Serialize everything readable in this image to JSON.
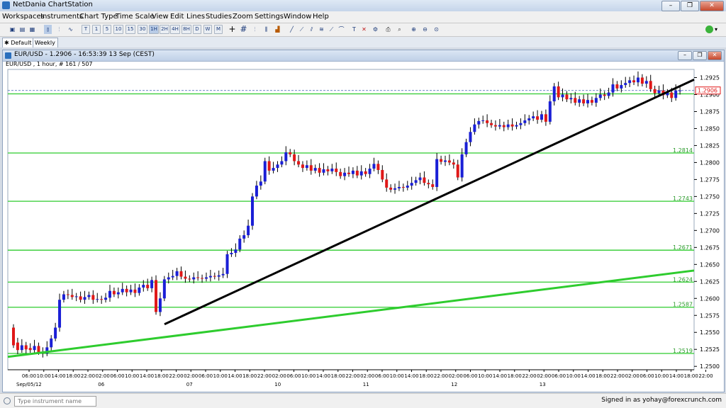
{
  "app": {
    "title": "NetDania ChartStation"
  },
  "menu": [
    "Workspaces",
    "Instruments",
    "Chart Type",
    "Time Scale",
    "View",
    "Edit",
    "Lines",
    "Studies",
    "Zoom",
    "Settings",
    "Window",
    "Help"
  ],
  "timeframes": [
    "T",
    "1",
    "5",
    "10",
    "15",
    "30",
    "1H",
    "2H",
    "4H",
    "8H",
    "D",
    "W",
    "M"
  ],
  "selected_timeframe": "1H",
  "tabs": [
    {
      "label": "Default"
    },
    {
      "label": "Weekly"
    }
  ],
  "chart_window": {
    "title": "EUR/USD - 1.2906 - 16:53:39 13 Sep (CEST)",
    "info": "EUR/USD , 1 hour, # 161 / 507"
  },
  "status": {
    "instrument_placeholder": "Type instrument name",
    "signed_in": "Signed in as yohay@forexcrunch.com"
  },
  "colors": {
    "up": "#1a1fd6",
    "down": "#e01818",
    "level_line": "#2ecc2e",
    "trend_black": "#000000",
    "trend_green": "#2ecc2e",
    "current_price": "#e01818"
  },
  "chart_data": {
    "type": "candlestick",
    "instrument": "EUR/USD",
    "interval": "1 hour",
    "y_ticks": [
      "1.2925",
      "1.2900",
      "1.2875",
      "1.2850",
      "1.2825",
      "1.2800",
      "1.2775",
      "1.2750",
      "1.2725",
      "1.2700",
      "1.2675",
      "1.2650",
      "1.2625",
      "1.2600",
      "1.2575",
      "1.2550",
      "1.2525",
      "1.2500"
    ],
    "ylim": [
      1.2495,
      1.2937
    ],
    "x_hour_ticks": [
      "06:00",
      "10:00",
      "14:00",
      "18:00",
      "22:00",
      "02:00",
      "06:00",
      "10:00",
      "14:00",
      "18:00",
      "22:00",
      "02:00",
      "06:00",
      "10:00",
      "14:00",
      "18:00",
      "22:00",
      "02:00",
      "06:00",
      "10:00",
      "14:00",
      "18:00",
      "22:00",
      "02:00",
      "06:00",
      "10:00",
      "14:00",
      "18:00",
      "22:00",
      "02:00",
      "06:00",
      "10:00",
      "14:00",
      "18:00",
      "22:00",
      "02:00",
      "06:00",
      "10:00",
      "14:00",
      "18:00",
      "22:00",
      "02:00",
      "06:00",
      "10:00",
      "14:00",
      "18:00",
      "22:00"
    ],
    "x_date_ticks": [
      "Sep/05/12",
      "06",
      "07",
      "10",
      "11",
      "12",
      "13"
    ],
    "current_price": "1.2906",
    "horizontal_levels": [
      "1.2814",
      "1.2743",
      "1.2671",
      "1.2624",
      "1.2587",
      "1.2519"
    ],
    "unlabeled_level": 1.2901,
    "trendlines": [
      {
        "color": "black",
        "from_price": 1.2562,
        "to_price": 1.2922
      },
      {
        "color": "green",
        "from_price": 1.2514,
        "to_price": 1.2641
      }
    ],
    "candles": [
      [
        1.2557,
        1.2531
      ],
      [
        1.2535,
        1.2524
      ],
      [
        1.2524,
        1.2531
      ],
      [
        1.2531,
        1.2525
      ],
      [
        1.2527,
        1.2524
      ],
      [
        1.2524,
        1.253
      ],
      [
        1.253,
        1.2521
      ],
      [
        1.2521,
        1.2519
      ],
      [
        1.2519,
        1.2528
      ],
      [
        1.2528,
        1.2541
      ],
      [
        1.2541,
        1.2557
      ],
      [
        1.2557,
        1.2598
      ],
      [
        1.2598,
        1.2606
      ],
      [
        1.2606,
        1.2605
      ],
      [
        1.2605,
        1.2602
      ],
      [
        1.2602,
        1.2603
      ],
      [
        1.2603,
        1.2598
      ],
      [
        1.2598,
        1.2602
      ],
      [
        1.2602,
        1.2605
      ],
      [
        1.2605,
        1.2598
      ],
      [
        1.2598,
        1.2599
      ],
      [
        1.2599,
        1.2598
      ],
      [
        1.2598,
        1.2601
      ],
      [
        1.2601,
        1.2611
      ],
      [
        1.2611,
        1.2606
      ],
      [
        1.2606,
        1.2609
      ],
      [
        1.2609,
        1.2614
      ],
      [
        1.2614,
        1.2609
      ],
      [
        1.2609,
        1.2613
      ],
      [
        1.2613,
        1.2608
      ],
      [
        1.2608,
        1.2616
      ],
      [
        1.2616,
        1.262
      ],
      [
        1.262,
        1.2615
      ],
      [
        1.2615,
        1.2627
      ],
      [
        1.2627,
        1.258
      ],
      [
        1.258,
        1.26
      ],
      [
        1.26,
        1.2628
      ],
      [
        1.2628,
        1.2631
      ],
      [
        1.2631,
        1.2633
      ],
      [
        1.2633,
        1.264
      ],
      [
        1.264,
        1.2632
      ],
      [
        1.2632,
        1.2629
      ],
      [
        1.2629,
        1.2628
      ],
      [
        1.2628,
        1.2631
      ],
      [
        1.2631,
        1.263
      ],
      [
        1.263,
        1.2629
      ],
      [
        1.2629,
        1.2631
      ],
      [
        1.2631,
        1.2633
      ],
      [
        1.2633,
        1.2632
      ],
      [
        1.2632,
        1.2634
      ],
      [
        1.2634,
        1.2636
      ],
      [
        1.2636,
        1.2665
      ],
      [
        1.2665,
        1.2667
      ],
      [
        1.2667,
        1.2672
      ],
      [
        1.2672,
        1.2688
      ],
      [
        1.2688,
        1.2693
      ],
      [
        1.2693,
        1.2707
      ],
      [
        1.2707,
        1.275
      ],
      [
        1.275,
        1.2766
      ],
      [
        1.2766,
        1.2772
      ],
      [
        1.2772,
        1.2802
      ],
      [
        1.2802,
        1.2788
      ],
      [
        1.2788,
        1.2792
      ],
      [
        1.2792,
        1.2797
      ],
      [
        1.2797,
        1.2802
      ],
      [
        1.2802,
        1.2815
      ],
      [
        1.2815,
        1.2812
      ],
      [
        1.2812,
        1.2802
      ],
      [
        1.2802,
        1.2797
      ],
      [
        1.2797,
        1.2792
      ],
      [
        1.2792,
        1.2796
      ],
      [
        1.2796,
        1.2788
      ],
      [
        1.2788,
        1.2792
      ],
      [
        1.2792,
        1.2785
      ],
      [
        1.2785,
        1.279
      ],
      [
        1.279,
        1.2787
      ],
      [
        1.2787,
        1.2791
      ],
      [
        1.2791,
        1.2786
      ],
      [
        1.2786,
        1.278
      ],
      [
        1.278,
        1.2785
      ],
      [
        1.2785,
        1.2783
      ],
      [
        1.2783,
        1.2788
      ],
      [
        1.2788,
        1.2781
      ],
      [
        1.2781,
        1.2787
      ],
      [
        1.2787,
        1.2783
      ],
      [
        1.2783,
        1.2791
      ],
      [
        1.2791,
        1.2798
      ],
      [
        1.2798,
        1.2789
      ],
      [
        1.2789,
        1.2775
      ],
      [
        1.2775,
        1.2763
      ],
      [
        1.2763,
        1.276
      ],
      [
        1.276,
        1.2762
      ],
      [
        1.2762,
        1.2764
      ],
      [
        1.2764,
        1.2763
      ],
      [
        1.2763,
        1.2766
      ],
      [
        1.2766,
        1.277
      ],
      [
        1.277,
        1.2774
      ],
      [
        1.2774,
        1.2778
      ],
      [
        1.2778,
        1.277
      ],
      [
        1.277,
        1.2768
      ],
      [
        1.2768,
        1.2764
      ],
      [
        1.2764,
        1.2805
      ],
      [
        1.2805,
        1.2801
      ],
      [
        1.2801,
        1.2803
      ],
      [
        1.2803,
        1.28
      ],
      [
        1.28,
        1.2797
      ],
      [
        1.2797,
        1.2778
      ],
      [
        1.2778,
        1.2812
      ],
      [
        1.2812,
        1.283
      ],
      [
        1.283,
        1.2845
      ],
      [
        1.2845,
        1.2856
      ],
      [
        1.2856,
        1.2861
      ],
      [
        1.2861,
        1.2862
      ],
      [
        1.2862,
        1.2858
      ],
      [
        1.2858,
        1.2855
      ],
      [
        1.2855,
        1.2853
      ],
      [
        1.2853,
        1.2855
      ],
      [
        1.2855,
        1.2852
      ],
      [
        1.2852,
        1.2856
      ],
      [
        1.2856,
        1.2853
      ],
      [
        1.2853,
        1.2855
      ],
      [
        1.2855,
        1.2858
      ],
      [
        1.2858,
        1.2862
      ],
      [
        1.2862,
        1.2865
      ],
      [
        1.2865,
        1.2868
      ],
      [
        1.2868,
        1.2863
      ],
      [
        1.2863,
        1.2871
      ],
      [
        1.2871,
        1.286
      ],
      [
        1.286,
        1.289
      ],
      [
        1.289,
        1.2912
      ],
      [
        1.2912,
        1.2896
      ],
      [
        1.2896,
        1.29
      ],
      [
        1.29,
        1.2893
      ],
      [
        1.2893,
        1.2895
      ],
      [
        1.2895,
        1.2888
      ],
      [
        1.2888,
        1.2893
      ],
      [
        1.2893,
        1.2887
      ],
      [
        1.2887,
        1.2892
      ],
      [
        1.2892,
        1.2888
      ],
      [
        1.2888,
        1.2895
      ],
      [
        1.2895,
        1.29
      ],
      [
        1.29,
        1.2898
      ],
      [
        1.2898,
        1.2903
      ],
      [
        1.2903,
        1.2915
      ],
      [
        1.2915,
        1.2909
      ],
      [
        1.2909,
        1.2914
      ],
      [
        1.2914,
        1.2917
      ],
      [
        1.2917,
        1.2921
      ],
      [
        1.2921,
        1.2918
      ],
      [
        1.2918,
        1.2925
      ],
      [
        1.2925,
        1.2916
      ],
      [
        1.2916,
        1.292
      ],
      [
        1.292,
        1.2908
      ],
      [
        1.2908,
        1.2902
      ],
      [
        1.2902,
        1.2906
      ],
      [
        1.2906,
        1.2899
      ],
      [
        1.2899,
        1.2903
      ],
      [
        1.2903,
        1.2895
      ],
      [
        1.2895,
        1.2906
      ],
      [
        1.2906,
        1.2906
      ]
    ]
  }
}
